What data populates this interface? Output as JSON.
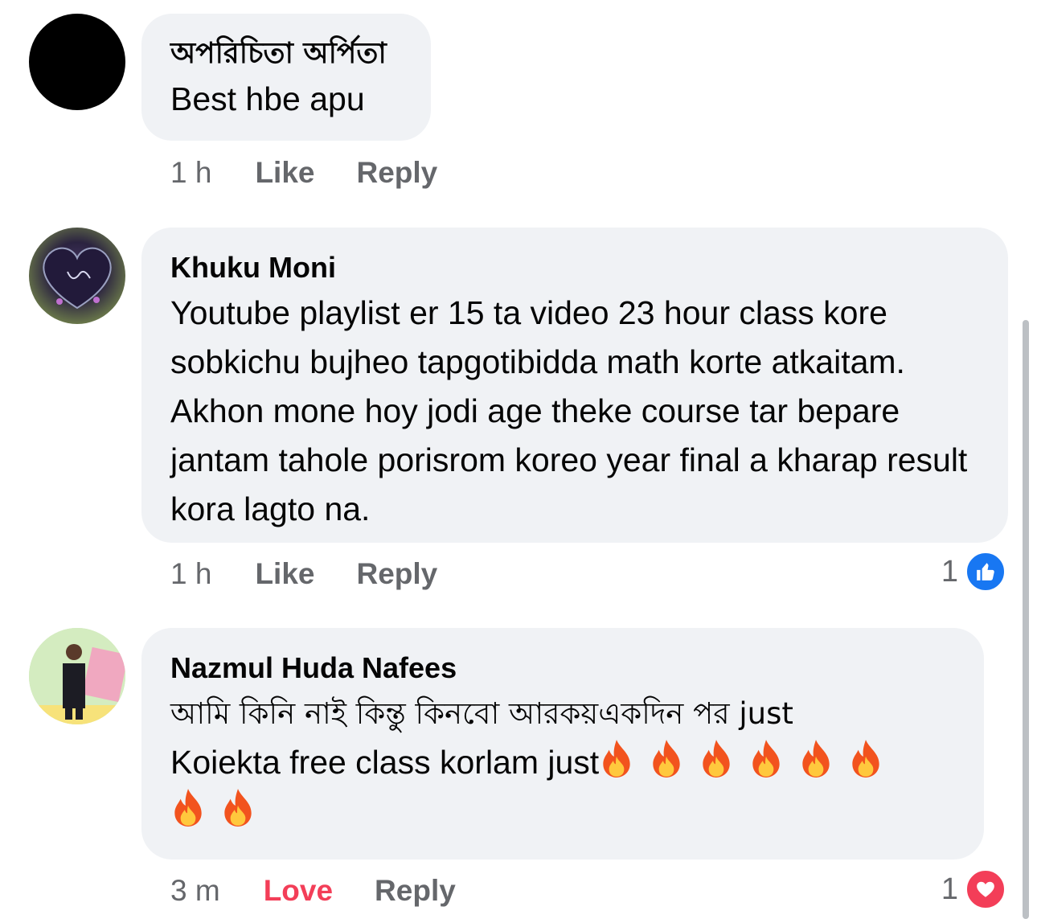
{
  "comments": [
    {
      "author": "অপরিচিতা অর্পিতা",
      "text": "Best hbe apu",
      "time": "1 h",
      "like_label": "Like",
      "reply_label": "Reply"
    },
    {
      "author": "Khuku Moni",
      "text": "Youtube playlist er 15 ta video 23 hour class kore sobkichu bujheo tapgotibidda math korte atkaitam. Akhon  mone hoy jodi age theke course tar bepare jantam tahole porisrom koreo year final a kharap result kora lagto na.",
      "time": "1 h",
      "like_label": "Like",
      "reply_label": "Reply",
      "reaction_count": "1",
      "reaction_icon": "like-icon"
    },
    {
      "author": "Nazmul Huda Nafees",
      "text_line1": "আমি কিনি নাই কিন্তু কিনবো আরকয়একদিন পর just",
      "text_line2": "Koiekta free class korlam just",
      "emoji": "🔥",
      "time": "3 m",
      "like_label": "Love",
      "reply_label": "Reply",
      "reaction_count": "1",
      "reaction_icon": "love-icon"
    }
  ],
  "colors": {
    "bubble": "#f0f2f5",
    "meta": "#65676b",
    "like": "#1877f2",
    "love": "#f33e58"
  }
}
